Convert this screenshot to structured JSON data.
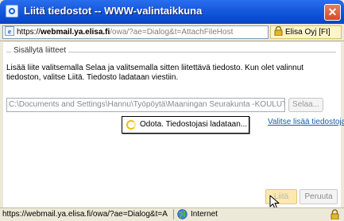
{
  "window": {
    "title": "Liitä tiedostot -- WWW-valintaikkuna",
    "close_glyph": "✕"
  },
  "address_bar": {
    "scheme": "https://",
    "host": "webmail.ya.elisa.fi",
    "path": "/owa/?ae=Dialog&t=AttachFileHost",
    "certificate_owner": "Elisa Oyj [FI]"
  },
  "dialog": {
    "group_label": "Sisällytä liitteet",
    "instructions": "Lisää liite valitsemalla Selaa ja valitsemalla sitten liitettävä tiedosto. Kun olet valinnut tiedoston, valitse Liitä. Tiedosto ladataan viestiin.",
    "file_path": "C:\\Documents and Settings\\Hannu\\Työpöytä\\Maaningan Seurakunta -KOULUTUS",
    "browse_label": "Selaa...",
    "add_more_label": "Valitse lisää tiedostoja",
    "loading_text": "Odota. Tiedostojasi ladataan...",
    "attach_label": "Liitä",
    "cancel_label": "Peruuta"
  },
  "status_bar": {
    "url": "https://webmail.ya.elisa.fi/owa/?ae=Dialog&t=A",
    "zone": "Internet"
  },
  "icons": {
    "window_icon": "ie-dialog-icon",
    "address_icon": "ie-page-icon",
    "certificate_icon": "padlock-icon",
    "loading_icon": "spinner-icon",
    "zone_icon": "globe-icon",
    "status_security_icon": "padlock-icon",
    "pointer": "arrow-cursor-icon"
  },
  "colors": {
    "titlebar": "#0a4fd6",
    "close_button": "#d34b25",
    "link": "#1a5fa8",
    "certificate_background": "#fdf5c9",
    "attach_button_highlight": "#fbe9b0"
  }
}
